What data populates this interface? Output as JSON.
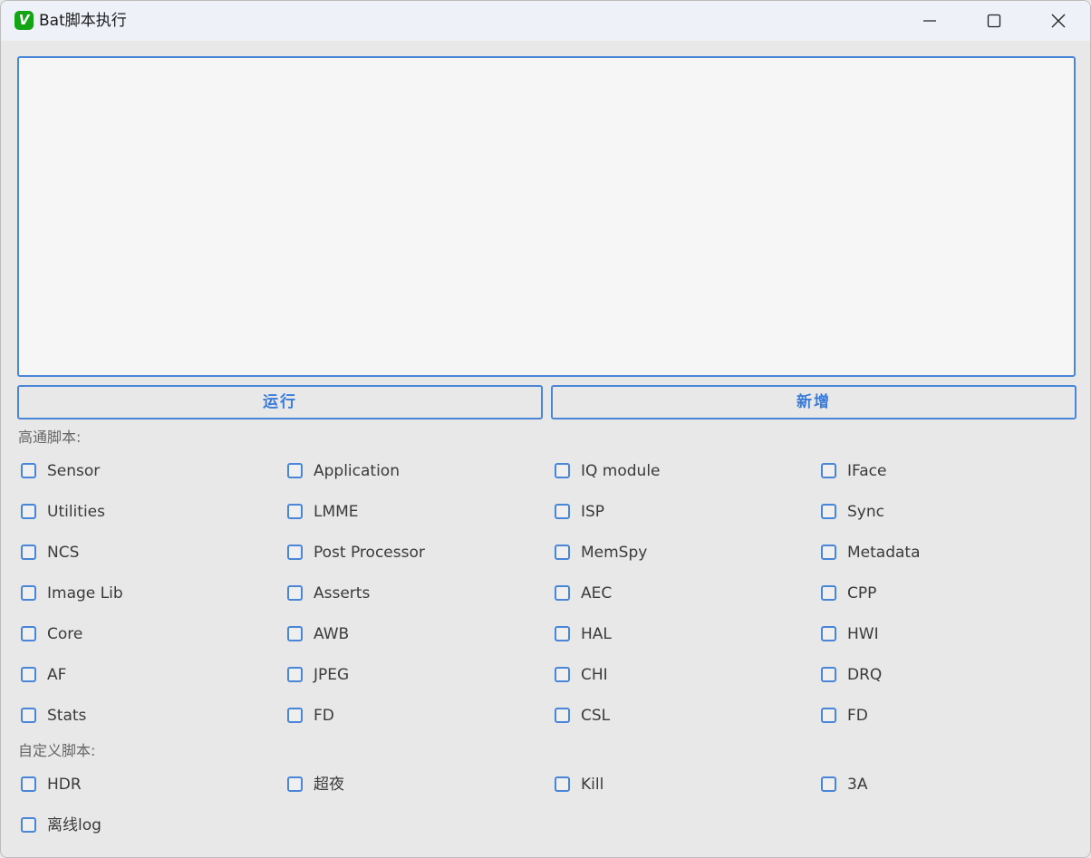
{
  "window": {
    "title": "Bat脚本执行",
    "icon_letter": "V"
  },
  "buttons": {
    "run": "运行",
    "add": "新增"
  },
  "qualcomm": {
    "label": "高通脚本:",
    "items": [
      "Sensor",
      "Application",
      "IQ module",
      "IFace",
      "Utilities",
      "LMME",
      "ISP",
      "Sync",
      "NCS",
      "Post Processor",
      "MemSpy",
      "Metadata",
      "Image Lib",
      "Asserts",
      "AEC",
      "CPP",
      "Core",
      "AWB",
      "HAL",
      "HWI",
      "AF",
      "JPEG",
      "CHI",
      "DRQ",
      "Stats",
      "FD",
      "CSL",
      "FD"
    ]
  },
  "custom": {
    "label": "自定义脚本:",
    "items": [
      "HDR",
      "超夜",
      "Kill",
      "3A",
      "离线log"
    ]
  },
  "colors": {
    "accent": "#4a86d8",
    "button_text": "#3b7bd9",
    "app_icon": "#14a514"
  }
}
